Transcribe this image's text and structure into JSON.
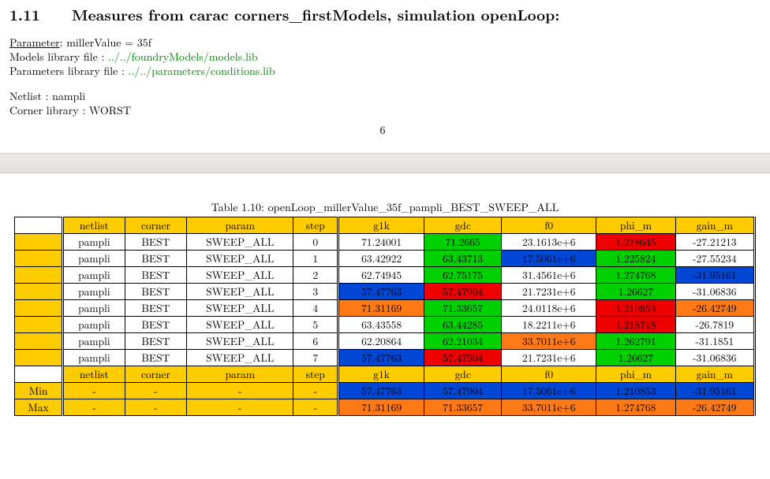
{
  "section": {
    "number": "1.11",
    "title": "Measures from carac corners_firstModels, simulation openLoop:"
  },
  "header": {
    "param_label": "Parameter",
    "param_text": ": millerValue = 35f",
    "models_label": "Models library file : ",
    "models_path": "../../foundryModels/models.lib",
    "params_label": "Parameters library file : ",
    "params_path": "../../parameters/conditions.lib",
    "netlist_line": "Netlist : nampli",
    "corner_line": "Corner library : WORST",
    "page_number": "6"
  },
  "table": {
    "caption": "Table 1.10: openLoop_millerValue_35f_pampli_BEST_SWEEP_ALL",
    "headers": [
      "netlist",
      "corner",
      "param",
      "step",
      "g1k",
      "gdc",
      "f0",
      "phi_m",
      "gain_m"
    ],
    "rows": [
      {
        "netlist": "pampli",
        "corner": "BEST",
        "param": "SWEEP_ALL",
        "step": "0",
        "g1k": {
          "v": "71.24001",
          "c": "white"
        },
        "gdc": {
          "v": "71.2665",
          "c": "green"
        },
        "f0": {
          "v": "23.1613e+6",
          "c": "white"
        },
        "phi_m": {
          "v": "1.218645",
          "c": "red"
        },
        "gain_m": {
          "v": "-27.21213",
          "c": "white"
        }
      },
      {
        "netlist": "pampli",
        "corner": "BEST",
        "param": "SWEEP_ALL",
        "step": "1",
        "g1k": {
          "v": "63.42922",
          "c": "white"
        },
        "gdc": {
          "v": "63.43713",
          "c": "green"
        },
        "f0": {
          "v": "17.5061e+6",
          "c": "blue"
        },
        "phi_m": {
          "v": "1.225824",
          "c": "green"
        },
        "gain_m": {
          "v": "-27.55234",
          "c": "white"
        }
      },
      {
        "netlist": "pampli",
        "corner": "BEST",
        "param": "SWEEP_ALL",
        "step": "2",
        "g1k": {
          "v": "62.74945",
          "c": "white"
        },
        "gdc": {
          "v": "62.75175",
          "c": "green"
        },
        "f0": {
          "v": "31.4561e+6",
          "c": "white"
        },
        "phi_m": {
          "v": "1.274768",
          "c": "green"
        },
        "gain_m": {
          "v": "-31.95161",
          "c": "blue"
        }
      },
      {
        "netlist": "pampli",
        "corner": "BEST",
        "param": "SWEEP_ALL",
        "step": "3",
        "g1k": {
          "v": "57.47763",
          "c": "blue"
        },
        "gdc": {
          "v": "57.47904",
          "c": "red"
        },
        "f0": {
          "v": "21.7231e+6",
          "c": "white"
        },
        "phi_m": {
          "v": "1.26627",
          "c": "green"
        },
        "gain_m": {
          "v": "-31.06836",
          "c": "white"
        }
      },
      {
        "netlist": "pampli",
        "corner": "BEST",
        "param": "SWEEP_ALL",
        "step": "4",
        "g1k": {
          "v": "71.31169",
          "c": "orange"
        },
        "gdc": {
          "v": "71.33657",
          "c": "green"
        },
        "f0": {
          "v": "24.0118e+6",
          "c": "white"
        },
        "phi_m": {
          "v": "1.210853",
          "c": "red"
        },
        "gain_m": {
          "v": "-26.42749",
          "c": "orange"
        }
      },
      {
        "netlist": "pampli",
        "corner": "BEST",
        "param": "SWEEP_ALL",
        "step": "5",
        "g1k": {
          "v": "63.43558",
          "c": "white"
        },
        "gdc": {
          "v": "63.44285",
          "c": "green"
        },
        "f0": {
          "v": "18.2211e+6",
          "c": "white"
        },
        "phi_m": {
          "v": "1.218718",
          "c": "red"
        },
        "gain_m": {
          "v": "-26.7819",
          "c": "white"
        }
      },
      {
        "netlist": "pampli",
        "corner": "BEST",
        "param": "SWEEP_ALL",
        "step": "6",
        "g1k": {
          "v": "62.20864",
          "c": "white"
        },
        "gdc": {
          "v": "62.21034",
          "c": "green"
        },
        "f0": {
          "v": "33.7011e+6",
          "c": "orange"
        },
        "phi_m": {
          "v": "1.262791",
          "c": "green"
        },
        "gain_m": {
          "v": "-31.1851",
          "c": "white"
        }
      },
      {
        "netlist": "pampli",
        "corner": "BEST",
        "param": "SWEEP_ALL",
        "step": "7",
        "g1k": {
          "v": "57.47763",
          "c": "blue"
        },
        "gdc": {
          "v": "57.47904",
          "c": "red"
        },
        "f0": {
          "v": "21.7231e+6",
          "c": "white"
        },
        "phi_m": {
          "v": "1.26627",
          "c": "green"
        },
        "gain_m": {
          "v": "-31.06836",
          "c": "white"
        }
      }
    ],
    "summary": {
      "min_label": "Min",
      "max_label": "Max",
      "dash": "-",
      "min": {
        "g1k": "57.47763",
        "gdc": "57.47904",
        "f0": "17.5061e+6",
        "phi_m": "1.210853",
        "gain_m": "-31.95161"
      },
      "max": {
        "g1k": "71.31169",
        "gdc": "71.33657",
        "f0": "33.7011e+6",
        "phi_m": "1.274768",
        "gain_m": "-26.42749"
      }
    }
  },
  "chart_data": {
    "type": "table",
    "title": "openLoop_millerValue_35f_pampli_BEST_SWEEP_ALL",
    "columns": [
      "netlist",
      "corner",
      "param",
      "step",
      "g1k",
      "gdc",
      "f0",
      "phi_m",
      "gain_m"
    ],
    "rows": [
      [
        "pampli",
        "BEST",
        "SWEEP_ALL",
        0,
        71.24001,
        71.2665,
        23161300.0,
        1.218645,
        -27.21213
      ],
      [
        "pampli",
        "BEST",
        "SWEEP_ALL",
        1,
        63.42922,
        63.43713,
        17506100.0,
        1.225824,
        -27.55234
      ],
      [
        "pampli",
        "BEST",
        "SWEEP_ALL",
        2,
        62.74945,
        62.75175,
        31456100.0,
        1.274768,
        -31.95161
      ],
      [
        "pampli",
        "BEST",
        "SWEEP_ALL",
        3,
        57.47763,
        57.47904,
        21723100.0,
        1.26627,
        -31.06836
      ],
      [
        "pampli",
        "BEST",
        "SWEEP_ALL",
        4,
        71.31169,
        71.33657,
        24011800.0,
        1.210853,
        -26.42749
      ],
      [
        "pampli",
        "BEST",
        "SWEEP_ALL",
        5,
        63.43558,
        63.44285,
        18221100.0,
        1.218718,
        -26.7819
      ],
      [
        "pampli",
        "BEST",
        "SWEEP_ALL",
        6,
        62.20864,
        62.21034,
        33701100.0,
        1.262791,
        -31.1851
      ],
      [
        "pampli",
        "BEST",
        "SWEEP_ALL",
        7,
        57.47763,
        57.47904,
        21723100.0,
        1.26627,
        -31.06836
      ]
    ],
    "min": {
      "g1k": 57.47763,
      "gdc": 57.47904,
      "f0": 17506100.0,
      "phi_m": 1.210853,
      "gain_m": -31.95161
    },
    "max": {
      "g1k": 71.31169,
      "gdc": 71.33657,
      "f0": 33701100.0,
      "phi_m": 1.274768,
      "gain_m": -26.42749
    }
  }
}
